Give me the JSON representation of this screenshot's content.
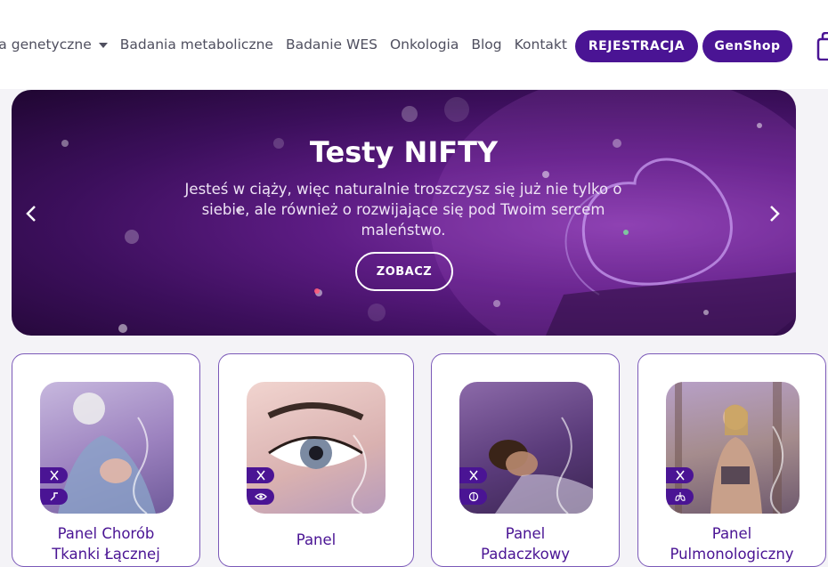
{
  "nav": {
    "items": [
      "ia genetyczne",
      "Badania metaboliczne",
      "Badanie WES",
      "Onkologia",
      "Blog",
      "Kontakt"
    ],
    "register_label": "REJESTRACJA",
    "shop_label": "GenShop",
    "cart_icon": "cart-icon"
  },
  "hero": {
    "title": "Testy NIFTY",
    "text": "Jesteś w ciąży, więc naturalnie troszczysz się już nie tylko o siebie, ale również o rozwijające się pod Twoim sercem maleństwo.",
    "cta": "ZOBACZ"
  },
  "cards": [
    {
      "title_line1": "Panel Chorób",
      "title_line2": "Tkanki Łącznej",
      "icons": [
        "dna-icon",
        "joint-icon"
      ]
    },
    {
      "title_line1": "Panel",
      "title_line2": "",
      "icons": [
        "dna-icon",
        "eye-icon"
      ]
    },
    {
      "title_line1": "Panel",
      "title_line2": "Padaczkowy",
      "icons": [
        "dna-icon",
        "brain-icon"
      ]
    },
    {
      "title_line1": "Panel",
      "title_line2": "Pulmonologiczny",
      "icons": [
        "dna-icon",
        "lungs-icon"
      ]
    }
  ],
  "colors": {
    "brand": "#4a1494",
    "hero_bg": "#5d1c84"
  }
}
